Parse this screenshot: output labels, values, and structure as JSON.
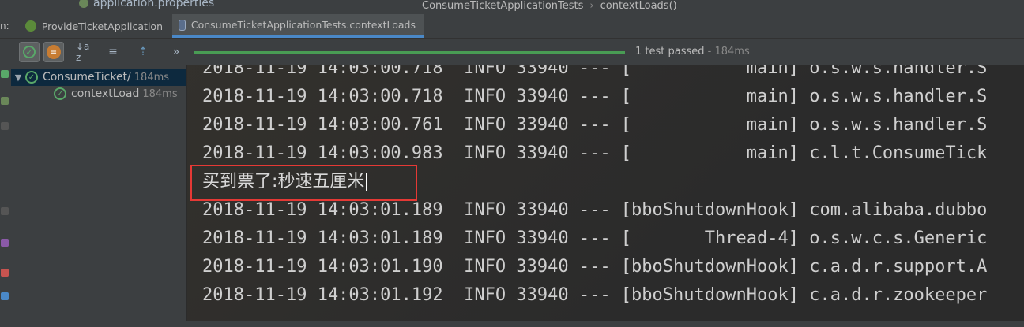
{
  "top_strip": {
    "file_name": "application.properties",
    "breadcrumb": [
      "ConsumeTicketApplicationTests",
      "contextLoads()"
    ],
    "breadcrumb_sep": "›"
  },
  "run_tabs": {
    "prefix": "n:",
    "tabs": [
      {
        "label": "ProvideTicketApplication",
        "active": false
      },
      {
        "label": "ConsumeTicketApplicationTests.contextLoads",
        "active": true
      }
    ]
  },
  "toolbar": {
    "sort_alpha": "↓a z",
    "sort_duration": "≡",
    "expand": "⇡",
    "more": "»",
    "progress_fraction": 1.0,
    "status": "1 test passed",
    "status_duration": " - 184ms"
  },
  "tree": {
    "root": {
      "label": "ConsumeTicket/",
      "time": "184ms"
    },
    "child": {
      "label": "contextLoad",
      "time": "184ms"
    }
  },
  "console": {
    "lines": [
      "2018-11-19 14:03:00.718  INFO 33940 --- [           main] o.s.w.s.handler.S",
      "2018-11-19 14:03:00.718  INFO 33940 --- [           main] o.s.w.s.handler.S",
      "2018-11-19 14:03:00.761  INFO 33940 --- [           main] o.s.w.s.handler.S",
      "2018-11-19 14:03:00.983  INFO 33940 --- [           main] c.l.t.ConsumeTick",
      "买到票了:秒速五厘米",
      "2018-11-19 14:03:01.189  INFO 33940 --- [bboShutdownHook] com.alibaba.dubbo",
      "2018-11-19 14:03:01.189  INFO 33940 --- [       Thread-4] o.s.w.c.s.Generic",
      "2018-11-19 14:03:01.190  INFO 33940 --- [bboShutdownHook] c.a.d.r.support.A",
      "2018-11-19 14:03:01.192  INFO 33940 --- [bboShutdownHook] c.a.d.r.zookeeper"
    ]
  },
  "colors": {
    "pass_green": "#59a869",
    "progress_green": "#499c54",
    "highlight_red": "#e53935",
    "console_bg": "#2b2b2b",
    "panel_bg": "#3c3f41"
  }
}
